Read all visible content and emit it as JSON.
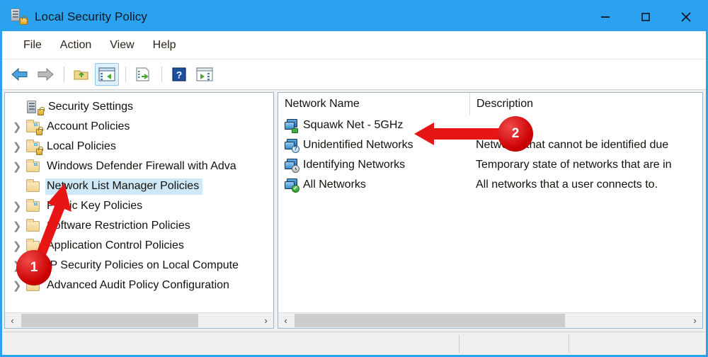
{
  "window": {
    "title": "Local Security Policy",
    "icon": "security-policy-icon",
    "minimize_label": "—",
    "maximize_label": "□",
    "close_label": "✕"
  },
  "menubar": {
    "items": [
      {
        "label": "File"
      },
      {
        "label": "Action"
      },
      {
        "label": "View"
      },
      {
        "label": "Help"
      }
    ]
  },
  "toolbar": {
    "buttons": [
      {
        "name": "back-button",
        "icon": "back-arrow-icon",
        "selected": false
      },
      {
        "name": "forward-button",
        "icon": "forward-arrow-icon",
        "selected": false
      },
      {
        "name": "up-one-level-button",
        "icon": "up-folder-icon",
        "selected": false
      },
      {
        "name": "show-hide-console-tree-button",
        "icon": "console-tree-icon",
        "selected": true
      },
      {
        "name": "export-list-button",
        "icon": "export-list-icon",
        "selected": false
      },
      {
        "name": "help-button",
        "icon": "question-mark-icon",
        "selected": false
      },
      {
        "name": "show-hide-action-pane-button",
        "icon": "action-pane-icon",
        "selected": false
      }
    ]
  },
  "tree": {
    "root": {
      "label": "Security Settings",
      "icon": "server-lock-icon"
    },
    "items": [
      {
        "label": "Account Policies",
        "icon": "folder-lock-icon",
        "expandable": true,
        "selected": false
      },
      {
        "label": "Local Policies",
        "icon": "folder-lock-icon",
        "expandable": true,
        "selected": false
      },
      {
        "label": "Windows Defender Firewall with Adva",
        "icon": "folder-icon",
        "expandable": true,
        "selected": false
      },
      {
        "label": "Network List Manager Policies",
        "icon": "folder-icon",
        "expandable": false,
        "selected": true
      },
      {
        "label": "Public Key Policies",
        "icon": "folder-icon",
        "expandable": true,
        "selected": false
      },
      {
        "label": "Software Restriction Policies",
        "icon": "folder-icon",
        "expandable": true,
        "selected": false
      },
      {
        "label": "Application Control Policies",
        "icon": "folder-icon",
        "expandable": true,
        "selected": false
      },
      {
        "label": "IP Security Policies on Local Compute",
        "icon": "folder-icon",
        "expandable": true,
        "selected": false
      },
      {
        "label": "Advanced Audit Policy Configuration",
        "icon": "folder-icon",
        "expandable": true,
        "selected": false
      }
    ]
  },
  "listview": {
    "columns": [
      {
        "label": "Network Name"
      },
      {
        "label": "Description"
      }
    ],
    "rows": [
      {
        "name": "Squawk Net - 5GHz",
        "description": "",
        "icon": "network-connected-icon",
        "badge": "plug"
      },
      {
        "name": "Unidentified Networks",
        "description": "Networks that cannot be identified due",
        "icon": "network-unidentified-icon",
        "badge": "?"
      },
      {
        "name": "Identifying Networks",
        "description": "Temporary state of networks that are in",
        "icon": "network-identifying-icon",
        "badge": "clock"
      },
      {
        "name": "All Networks",
        "description": "All networks that a user connects to.",
        "icon": "network-all-icon",
        "badge": "check"
      }
    ]
  },
  "scrollbars": {
    "left_arrow": "‹",
    "right_arrow": "›"
  },
  "statusbar": {
    "segment1": "",
    "segment2": "",
    "segment3": ""
  },
  "annotations": [
    {
      "label": "1",
      "target": "network-list-manager-policies-tree-item"
    },
    {
      "label": "2",
      "target": "squawk-net-5ghz-list-item"
    }
  ],
  "colors": {
    "titlebar": "#2ba2f0",
    "selection": "#cfe8f7",
    "annotation": "#cc0000"
  }
}
